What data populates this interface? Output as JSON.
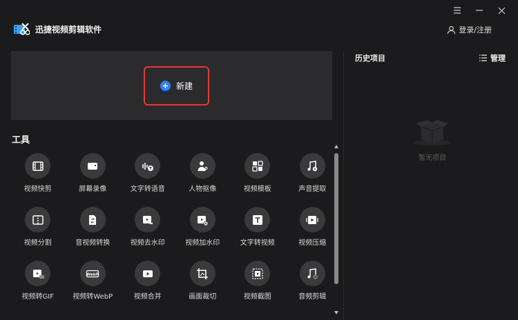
{
  "app": {
    "title": "迅捷视频剪辑软件"
  },
  "window": {
    "menu_icon": "menu-icon",
    "min_icon": "minimize-icon",
    "close_icon": "close-icon"
  },
  "header": {
    "login_label": "登录/注册",
    "login_icon": "user-icon"
  },
  "new_project": {
    "label": "新建",
    "icon": "plus-circle-icon",
    "icon_color": "#2f7fff",
    "highlight_color": "#e53935"
  },
  "tools": {
    "heading": "工具",
    "items": [
      {
        "label": "视频快剪",
        "icon": "film-icon"
      },
      {
        "label": "屏幕录像",
        "icon": "camera-icon"
      },
      {
        "label": "文字转语音",
        "icon": "text-to-speech-icon"
      },
      {
        "label": "人物抠像",
        "icon": "person-icon"
      },
      {
        "label": "视频模板",
        "icon": "template-icon"
      },
      {
        "label": "声音提取",
        "icon": "music-note-icon"
      },
      {
        "label": "视频分割",
        "icon": "split-icon"
      },
      {
        "label": "音视频转换",
        "icon": "convert-icon"
      },
      {
        "label": "视频去水印",
        "icon": "remove-watermark-icon"
      },
      {
        "label": "视频加水印",
        "icon": "add-watermark-icon"
      },
      {
        "label": "文字转视频",
        "icon": "text-icon"
      },
      {
        "label": "视频压缩",
        "icon": "compress-icon"
      },
      {
        "label": "视频转GIF",
        "icon": "gif-icon"
      },
      {
        "label": "视频转WebP",
        "icon": "webp-icon"
      },
      {
        "label": "视频合并",
        "icon": "merge-icon"
      },
      {
        "label": "画面裁切",
        "icon": "crop-icon"
      },
      {
        "label": "视频截图",
        "icon": "screenshot-icon"
      },
      {
        "label": "音频剪辑",
        "icon": "audio-cut-icon"
      }
    ]
  },
  "history": {
    "title": "历史项目",
    "manage_label": "管理",
    "manage_icon": "list-icon",
    "empty_label": "暂无项目",
    "empty_icon": "empty-box-icon"
  }
}
